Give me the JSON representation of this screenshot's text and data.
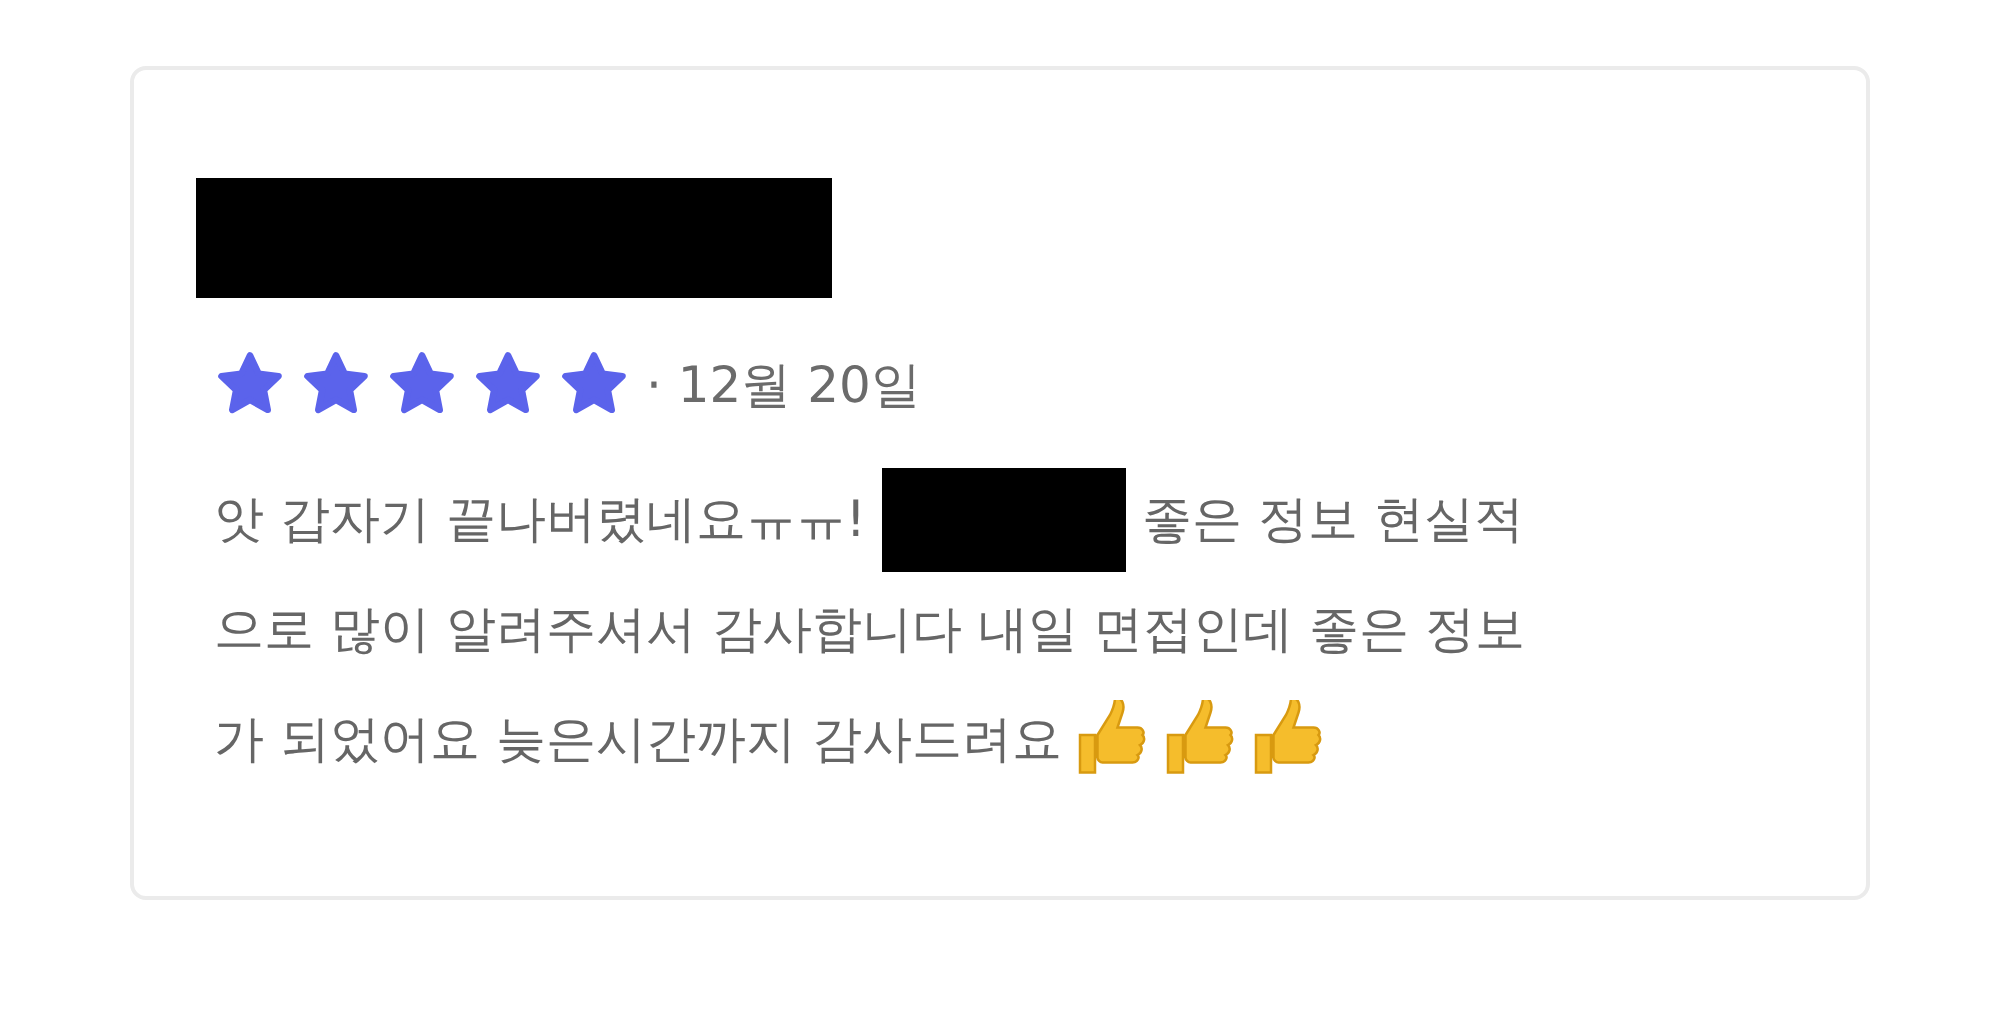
{
  "review": {
    "stars": 5,
    "date": "· 12월 20일",
    "lines": [
      "앗 갑자기 끝나버렸네요ㅠㅠ!",
      "좋은 정보 현실적",
      "으로 많이 알려주셔서 감사합니다 내일 면접인데 좋은 정보",
      "가 되었어요 늦은시간까지 감사드려요"
    ],
    "emojis": [
      {
        "kind": "thumbs-up"
      },
      {
        "kind": "thumbs-up"
      },
      {
        "kind": "thumbs-up"
      }
    ]
  }
}
